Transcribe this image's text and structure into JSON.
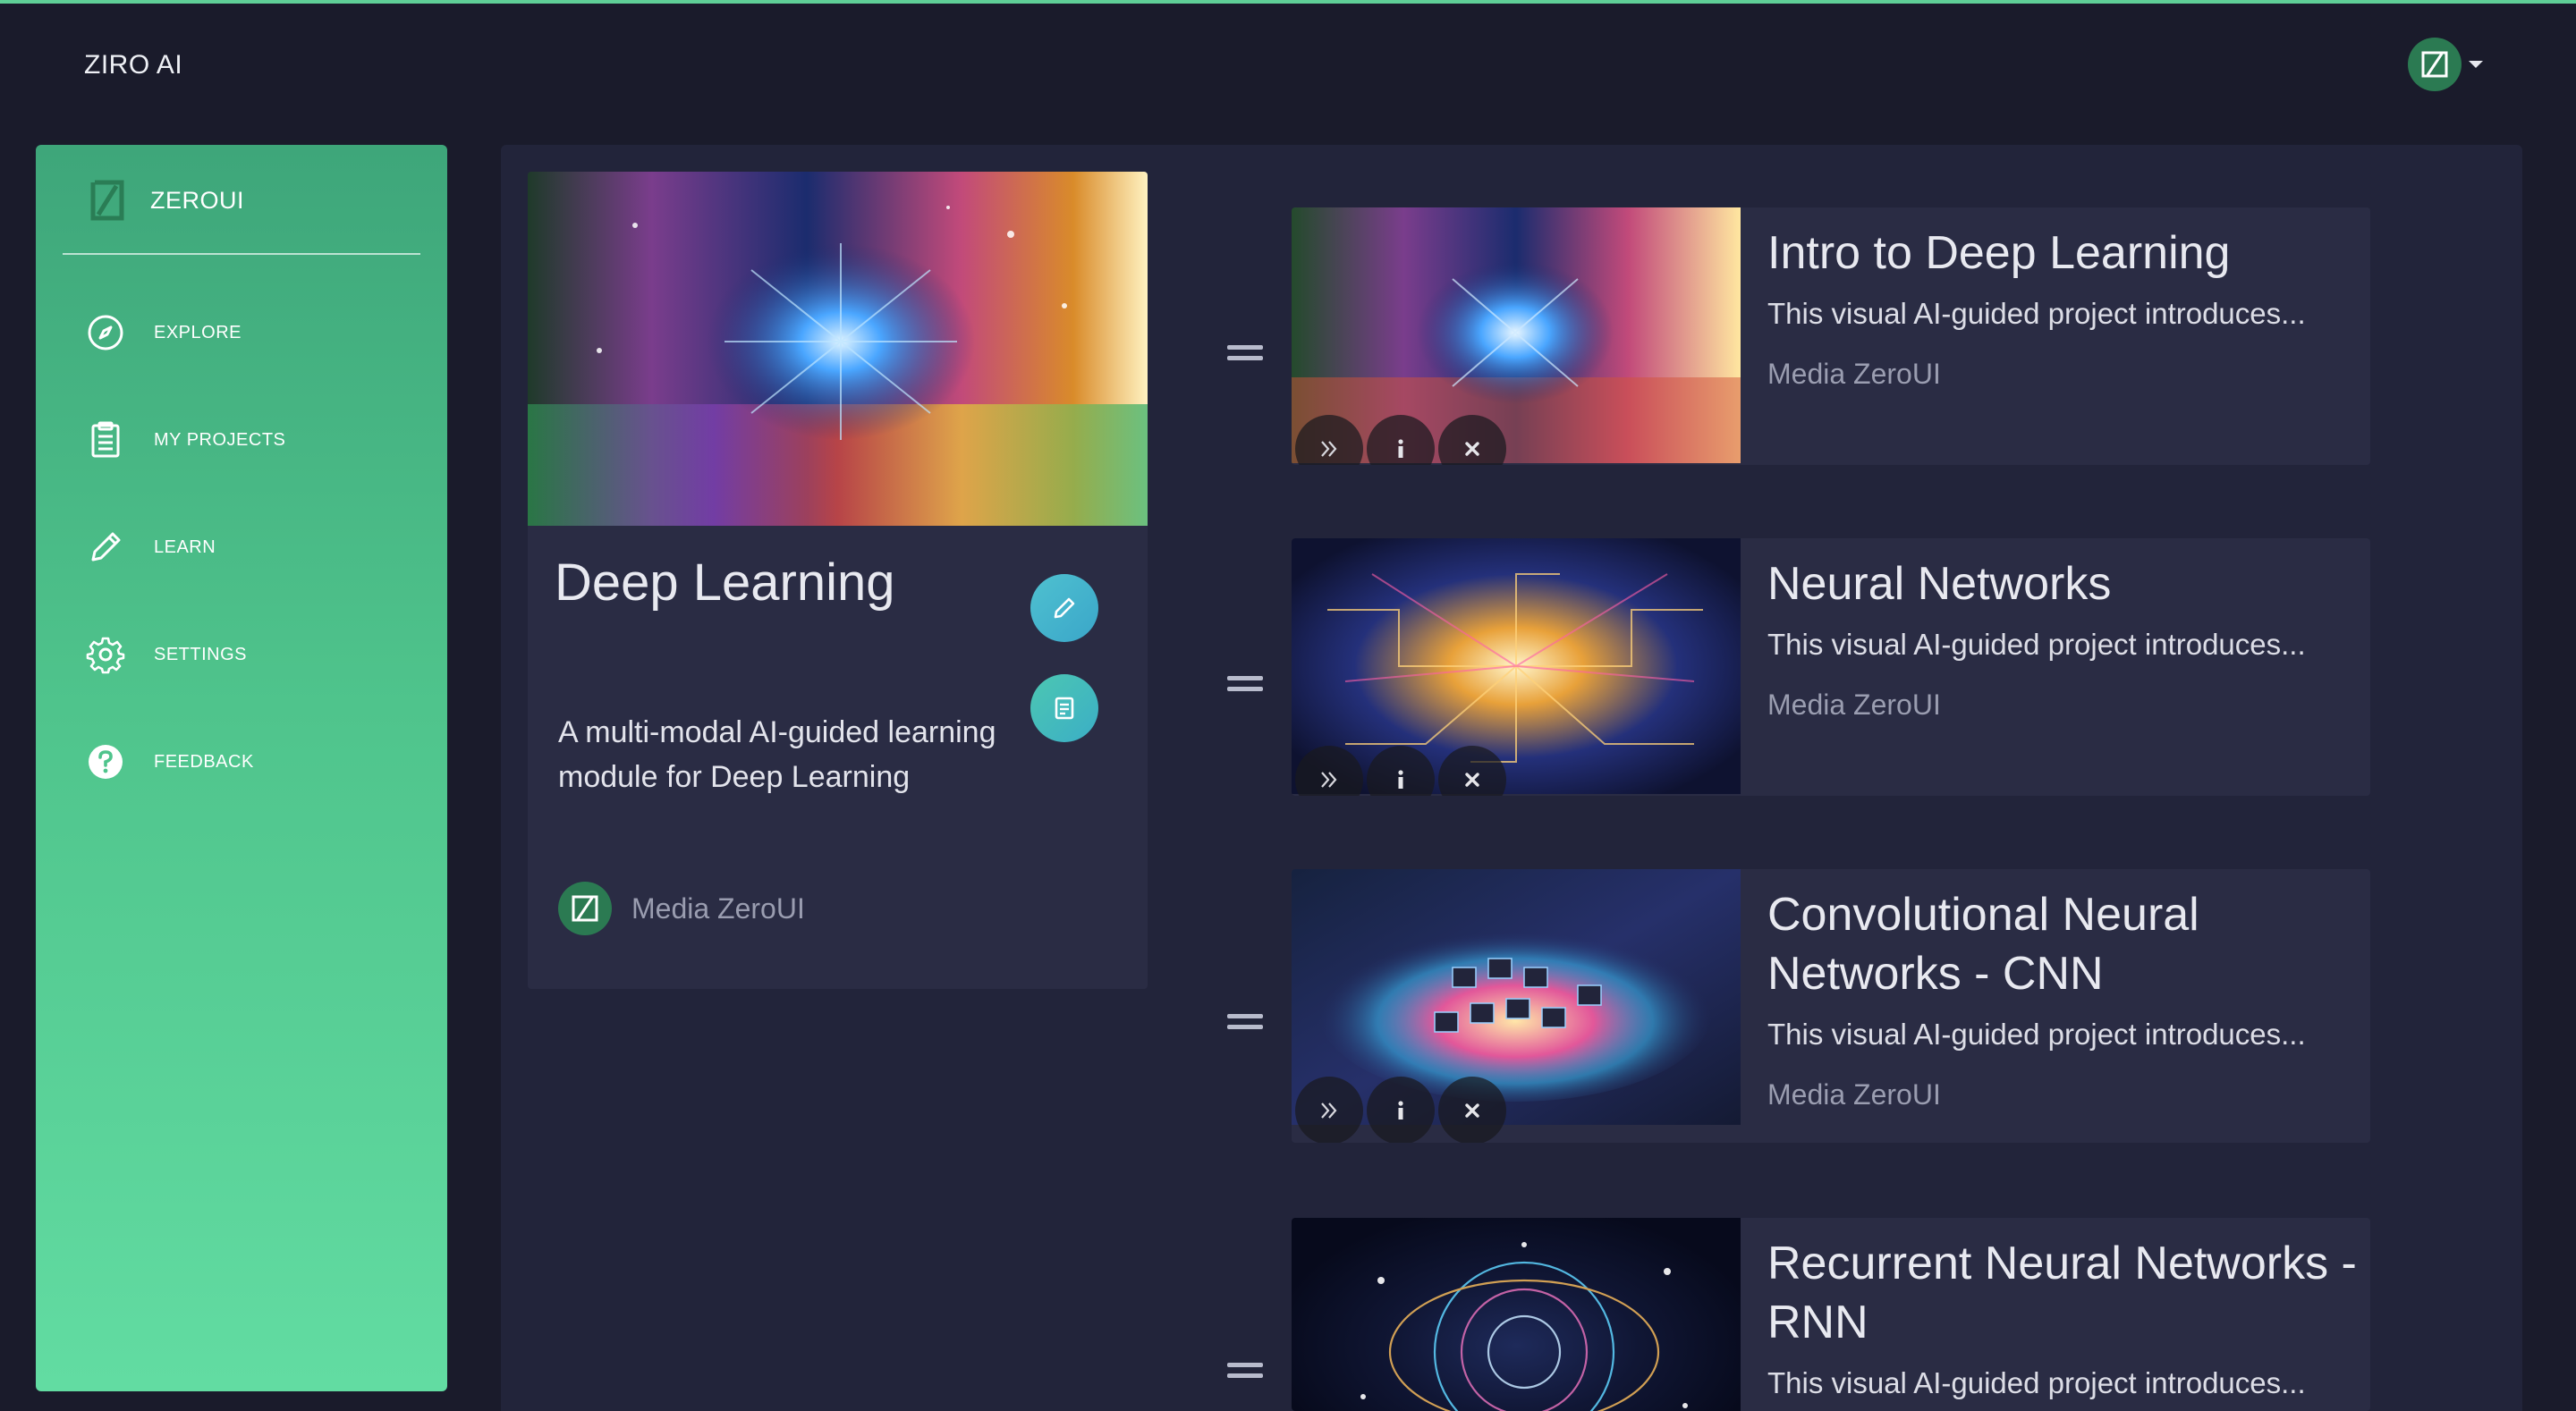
{
  "header": {
    "brand": "ZIRO AI"
  },
  "sidebar": {
    "brand": "ZEROUI",
    "items": [
      {
        "label": "EXPLORE",
        "icon": "compass-icon"
      },
      {
        "label": "MY PROJECTS",
        "icon": "clipboard-icon"
      },
      {
        "label": "LEARN",
        "icon": "pencil-icon"
      },
      {
        "label": "SETTINGS",
        "icon": "gear-icon"
      },
      {
        "label": "FEEDBACK",
        "icon": "question-circle-icon"
      }
    ]
  },
  "module": {
    "title": "Deep Learning",
    "description": "A multi-modal AI-guided learning module for Deep Learning",
    "author": "Media ZeroUI"
  },
  "lessons": [
    {
      "title": "Intro to Deep Learning",
      "description": "This visual AI-guided project introduces...",
      "author": "Media ZeroUI"
    },
    {
      "title": "Neural Networks",
      "description": "This visual AI-guided project introduces...",
      "author": "Media ZeroUI"
    },
    {
      "title": "Convolutional Neural Networks - CNN",
      "description": "This visual AI-guided project introduces...",
      "author": "Media ZeroUI"
    },
    {
      "title": "Recurrent Neural Networks - RNN",
      "description": "This visual AI-guided project introduces..."
    }
  ],
  "colors": {
    "accent": "#5fcf97",
    "sidebar_top": "#3ea67a",
    "sidebar_bottom": "#62dca2",
    "background": "#1a1b2b",
    "card": "#2a2c44"
  }
}
